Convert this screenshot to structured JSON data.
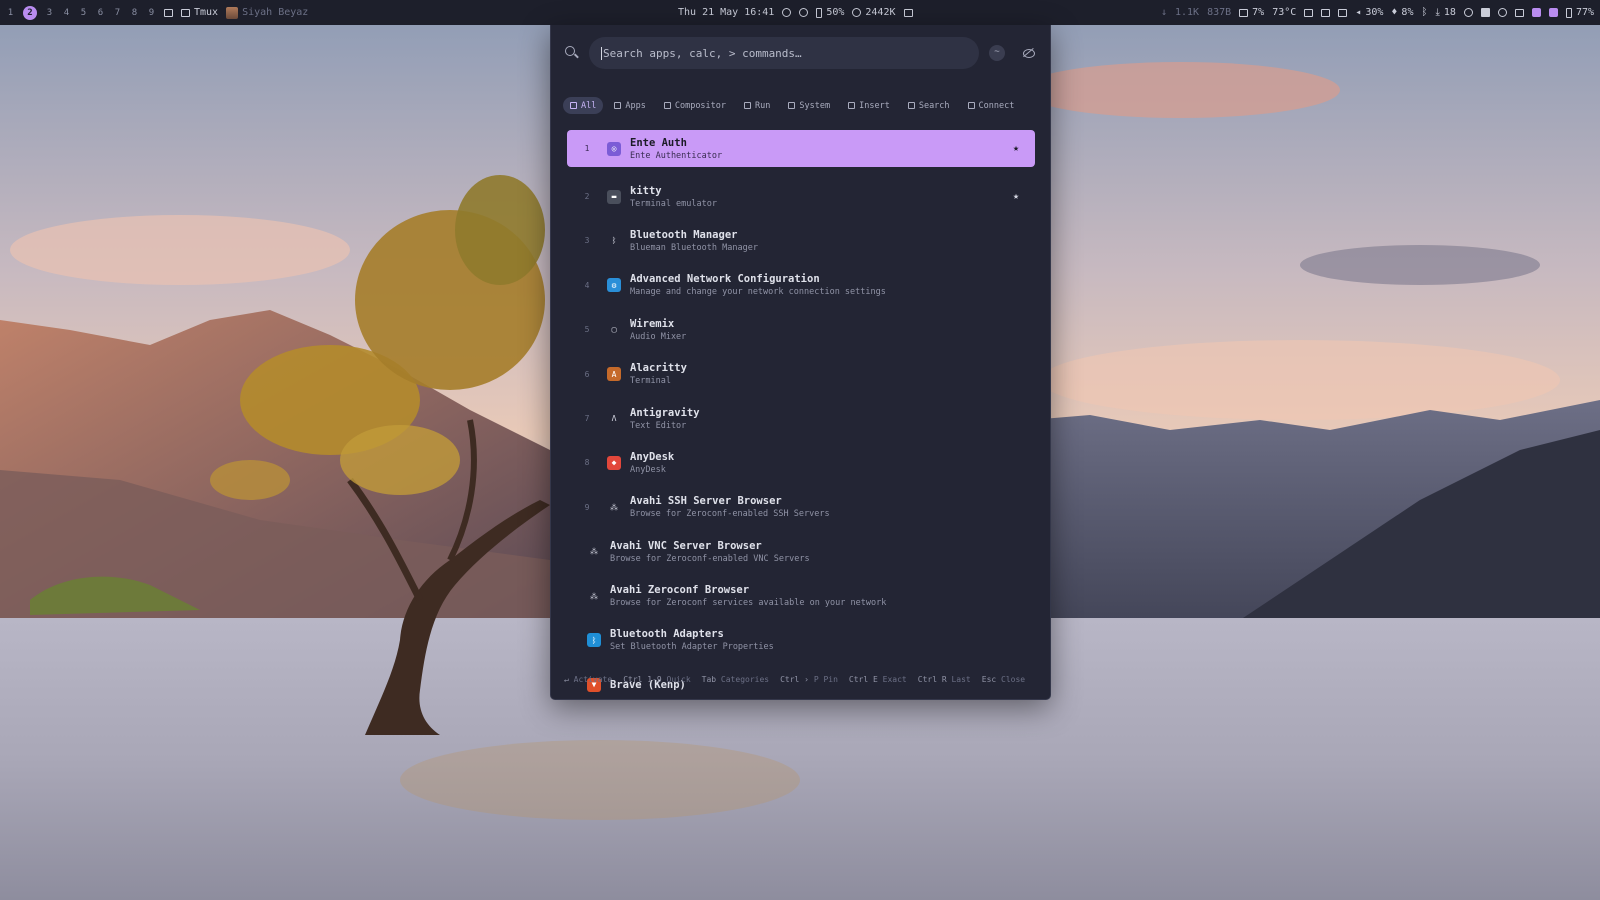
{
  "topbar": {
    "workspaces": [
      "1",
      "2",
      "3",
      "4",
      "5",
      "6",
      "7",
      "8",
      "9"
    ],
    "active_workspace": "2",
    "window_title": "Tmux",
    "user": "Siyah Beyaz",
    "datetime": "Thu 21 May 16:41",
    "battery_center": "50%",
    "memory": "2442K",
    "net_down": "1.1K",
    "net_up": "837B",
    "cpu": "7%",
    "temperature": "73°C",
    "volume": "30%",
    "mic": "8%",
    "updates": "18",
    "battery": "77%"
  },
  "launcher": {
    "search": {
      "placeholder": "Search apps, calc, > commands…",
      "clear_label": "~"
    },
    "tabs": [
      {
        "label": "All"
      },
      {
        "label": "Apps"
      },
      {
        "label": "Compositor"
      },
      {
        "label": "Run"
      },
      {
        "label": "System"
      },
      {
        "label": "Insert"
      },
      {
        "label": "Search"
      },
      {
        "label": "Connect"
      }
    ],
    "results": [
      {
        "num": "1",
        "title": "Ente Auth",
        "subtitle": "Ente Authenticator",
        "star": "★",
        "icon_name": "ente-auth-icon",
        "icon_color": "#7b5cd6",
        "icon_glyph": "◎"
      },
      {
        "num": "2",
        "title": "kitty",
        "subtitle": "Terminal emulator",
        "star": "★",
        "icon_name": "kitty-icon",
        "icon_color": "#4a4f5c",
        "icon_glyph": "▬"
      },
      {
        "num": "3",
        "title": "Bluetooth Manager",
        "subtitle": "Blueman Bluetooth Manager",
        "star": "",
        "icon_name": "bluetooth-icon",
        "icon_color": "transparent",
        "icon_glyph": "ᛒ"
      },
      {
        "num": "4",
        "title": "Advanced Network Configuration",
        "subtitle": "Manage and change your network connection settings",
        "star": "",
        "icon_name": "network-config-icon",
        "icon_color": "#2a8fd8",
        "icon_glyph": "⚙"
      },
      {
        "num": "5",
        "title": "Wiremix",
        "subtitle": "Audio Mixer",
        "star": "",
        "icon_name": "wiremix-icon",
        "icon_color": "transparent",
        "icon_glyph": "▢"
      },
      {
        "num": "6",
        "title": "Alacritty",
        "subtitle": "Terminal",
        "star": "",
        "icon_name": "alacritty-icon",
        "icon_color": "#c56a2a",
        "icon_glyph": "A"
      },
      {
        "num": "7",
        "title": "Antigravity",
        "subtitle": "Text Editor",
        "star": "",
        "icon_name": "antigravity-icon",
        "icon_color": "transparent",
        "icon_glyph": "Λ"
      },
      {
        "num": "8",
        "title": "AnyDesk",
        "subtitle": "AnyDesk",
        "star": "",
        "icon_name": "anydesk-icon",
        "icon_color": "#e2473b",
        "icon_glyph": "◆"
      },
      {
        "num": "9",
        "title": "Avahi SSH Server Browser",
        "subtitle": "Browse for Zeroconf-enabled SSH Servers",
        "star": "",
        "icon_name": "avahi-icon",
        "icon_color": "transparent",
        "icon_glyph": "⁂"
      },
      {
        "num": "",
        "title": "Avahi VNC Server Browser",
        "subtitle": "Browse for Zeroconf-enabled VNC Servers",
        "star": "",
        "icon_name": "avahi-icon",
        "icon_color": "transparent",
        "icon_glyph": "⁂"
      },
      {
        "num": "",
        "title": "Avahi Zeroconf Browser",
        "subtitle": "Browse for Zeroconf services available on your network",
        "star": "",
        "icon_name": "avahi-icon",
        "icon_color": "transparent",
        "icon_glyph": "⁂"
      },
      {
        "num": "",
        "title": "Bluetooth Adapters",
        "subtitle": "Set Bluetooth Adapter Properties",
        "star": "",
        "icon_name": "bluetooth-adapters-icon",
        "icon_color": "#1f8fd6",
        "icon_glyph": "ᛒ"
      },
      {
        "num": "",
        "title": "Brave (Kenp)",
        "subtitle": "",
        "star": "",
        "icon_name": "brave-icon",
        "icon_color": "#e0502a",
        "icon_glyph": "▼"
      }
    ],
    "footer": [
      {
        "key": "↵",
        "label": "Activate"
      },
      {
        "key": "Ctrl 1-9",
        "label": "Quick"
      },
      {
        "key": "Tab",
        "label": "Categories"
      },
      {
        "key": "Ctrl ›",
        "label": "P Pin"
      },
      {
        "key": "Ctrl E",
        "label": "Exact"
      },
      {
        "key": "Ctrl R",
        "label": "Last"
      },
      {
        "key": "Esc",
        "label": "Close"
      }
    ],
    "accent_color": "#c99af7"
  }
}
